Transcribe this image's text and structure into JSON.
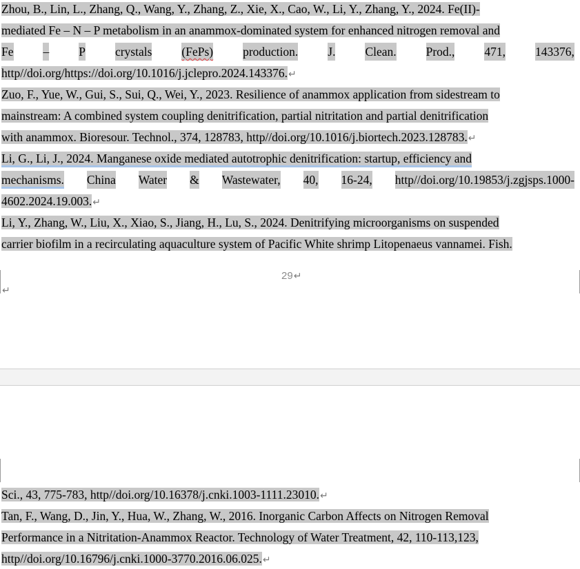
{
  "page1": {
    "lines": [
      "Zhou, B., Lin, L., Zhang, Q., Wang, Y., Zhang, Z., Xie, X., Cao, W., Li, Y., Zhang, Y., 2024. Fe(II)-",
      "mediated Fe – N – P metabolism in an anammox-dominated system for enhanced nitrogen removal and",
      [
        "Fe",
        "–",
        "P",
        "crystals",
        "(FePs)",
        "production.",
        "J.",
        "Clean.",
        "Prod.,",
        "471,",
        "143376,"
      ],
      "http//doi.org/https://doi.org/10.1016/j.jclepro.2024.143376.",
      "Zuo, F., Yue, W., Gui, S., Sui, Q., Wei, Y., 2023. Resilience of anammox application from sidestream to",
      "mainstream: A combined system coupling denitrification, partial nitritation and partial denitrification",
      "with anammox. Bioresour. Technol., 374, 128783, http//doi.org/10.1016/j.biortech.2023.128783.",
      "Li, G., Li, J., 2024. Manganese oxide mediated autotrophic denitrification: startup, efficiency and",
      [
        "mechanisms.",
        "China",
        "Water",
        "&",
        "Wastewater,",
        "40,",
        "16-24,",
        "http//doi.org/10.19853/j.zgjsps.1000-"
      ],
      "4602.2024.19.003.",
      "Li, Y., Zhang, W., Liu, X., Xiao, S., Jiang, H., Lu, S., 2024. Denitrifying microorganisms on suspended",
      "carrier biofilm in a recirculating aquaculture system of Pacific White shrimp Litopenaeus vannamei. Fish."
    ],
    "page_number": "29"
  },
  "page2": {
    "lines": [
      "Sci., 43, 775-783, http//doi.org/10.16378/j.cnki.1003-1111.23010.",
      "Tan, F., Wang, D., Jin, Y., Hua, W., Zhang, W., 2016. Inorganic Carbon Affects on Nitrogen Removal",
      "Performance in a Nitritation-Anammox Reactor. Technology of Water Treatment, 42, 110-113,123,",
      "http//doi.org/10.16796/j.cnki.1000-3770.2016.06.025."
    ]
  },
  "marks": {
    "paragraph": "↵"
  },
  "colors": {
    "highlight": "#c8c8c8",
    "spelling_underline": "#e0393e",
    "grammar_underline": "#a7c4e8"
  }
}
